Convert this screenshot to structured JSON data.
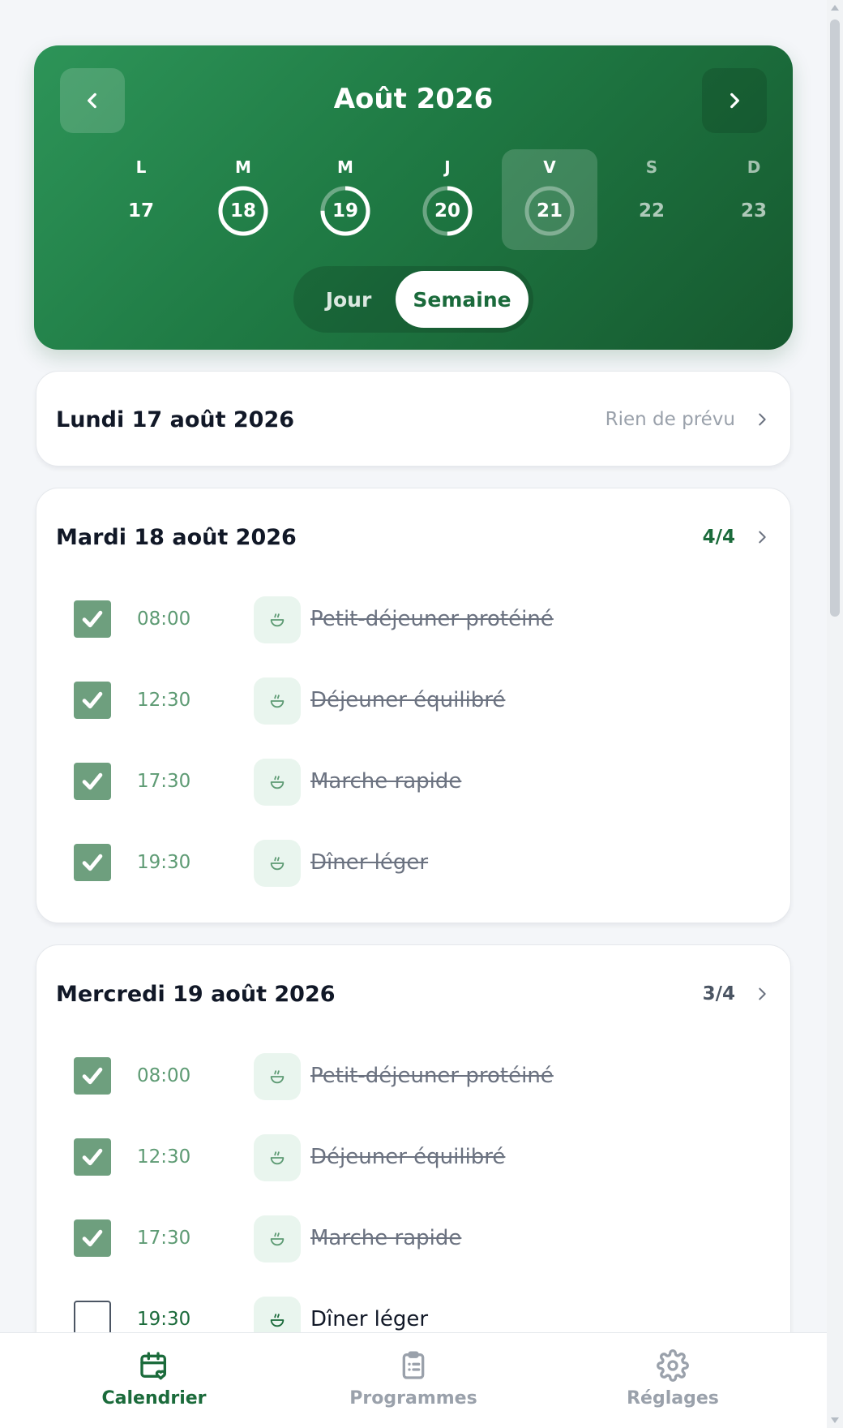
{
  "header": {
    "month_title": "Août 2026",
    "days": [
      {
        "letter": "L",
        "number": "17",
        "progress": null,
        "selected": false,
        "future": false
      },
      {
        "letter": "M",
        "number": "18",
        "progress": 1.0,
        "selected": false,
        "future": false
      },
      {
        "letter": "M",
        "number": "19",
        "progress": 0.75,
        "selected": false,
        "future": false
      },
      {
        "letter": "J",
        "number": "20",
        "progress": 0.5,
        "selected": false,
        "future": false
      },
      {
        "letter": "V",
        "number": "21",
        "progress": 0.0,
        "selected": true,
        "future": false
      },
      {
        "letter": "S",
        "number": "22",
        "progress": null,
        "selected": false,
        "future": true
      },
      {
        "letter": "D",
        "number": "23",
        "progress": null,
        "selected": false,
        "future": true
      }
    ],
    "view_toggle": {
      "day": "Jour",
      "week": "Semaine",
      "active": "week"
    }
  },
  "cards": [
    {
      "title": "Lundi 17 août 2026",
      "status": "Rien de prévu",
      "status_kind": "empty",
      "tasks": []
    },
    {
      "title": "Mardi 18 août 2026",
      "status": "4/4",
      "status_kind": "complete",
      "tasks": [
        {
          "time": "08:00",
          "name": "Petit-déjeuner protéiné",
          "done": true
        },
        {
          "time": "12:30",
          "name": "Déjeuner équilibré",
          "done": true
        },
        {
          "time": "17:30",
          "name": "Marche rapide",
          "done": true
        },
        {
          "time": "19:30",
          "name": "Dîner léger",
          "done": true
        }
      ]
    },
    {
      "title": "Mercredi 19 août 2026",
      "status": "3/4",
      "status_kind": "partial",
      "tasks": [
        {
          "time": "08:00",
          "name": "Petit-déjeuner protéiné",
          "done": true
        },
        {
          "time": "12:30",
          "name": "Déjeuner équilibré",
          "done": true
        },
        {
          "time": "17:30",
          "name": "Marche rapide",
          "done": true
        },
        {
          "time": "19:30",
          "name": "Dîner léger",
          "done": false
        }
      ]
    }
  ],
  "bottom_nav": {
    "items": [
      {
        "label": "Calendrier",
        "icon": "calendar-heart-icon",
        "active": true
      },
      {
        "label": "Programmes",
        "icon": "clipboard-list-icon",
        "active": false
      },
      {
        "label": "Réglages",
        "icon": "gear-icon",
        "active": false
      }
    ]
  },
  "colors": {
    "brand": "#1f7a44",
    "brand_dark": "#16592f",
    "accent_text": "#1b6b3b",
    "checked": "#6e9f7e",
    "icon_bg": "#e9f5ee"
  }
}
